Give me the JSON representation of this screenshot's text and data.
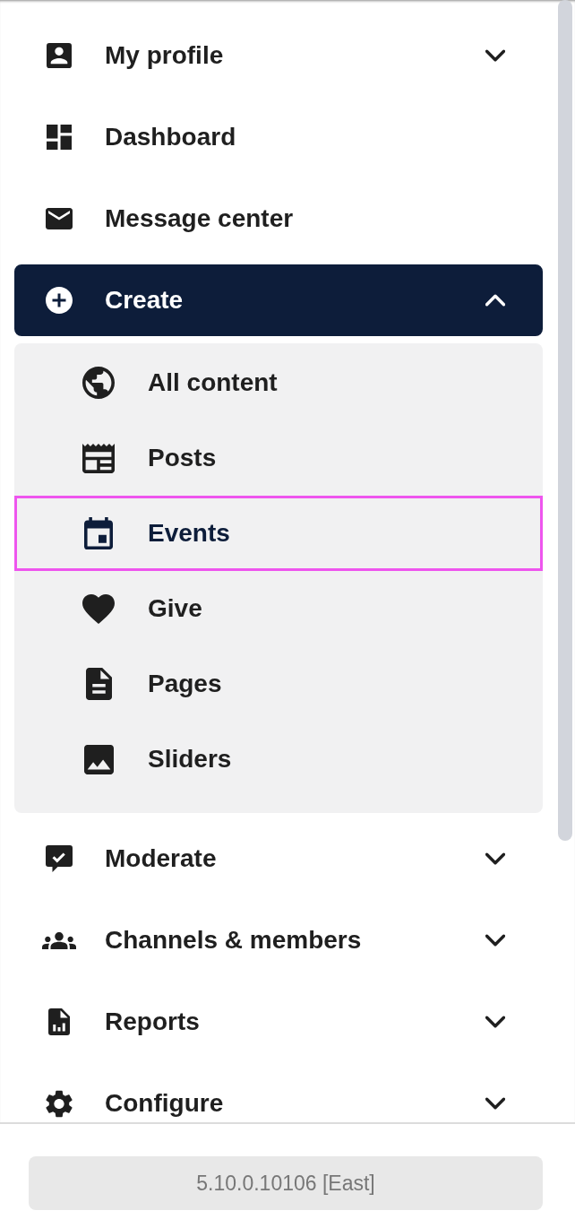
{
  "nav": {
    "items": [
      {
        "label": "My profile",
        "kind": "group",
        "expanded": false,
        "selected": false
      },
      {
        "label": "Dashboard",
        "kind": "link",
        "selected": false
      },
      {
        "label": "Message center",
        "kind": "link",
        "selected": false
      },
      {
        "label": "Create",
        "kind": "group",
        "expanded": true,
        "selected": false,
        "children": [
          {
            "label": "All content",
            "selected": false
          },
          {
            "label": "Posts",
            "selected": false
          },
          {
            "label": "Events",
            "selected": true
          },
          {
            "label": "Give",
            "selected": false
          },
          {
            "label": "Pages",
            "selected": false
          },
          {
            "label": "Sliders",
            "selected": false
          }
        ]
      },
      {
        "label": "Moderate",
        "kind": "group",
        "expanded": false,
        "selected": false
      },
      {
        "label": "Channels & members",
        "kind": "group",
        "expanded": false,
        "selected": false
      },
      {
        "label": "Reports",
        "kind": "group",
        "expanded": false,
        "selected": false
      },
      {
        "label": "Configure",
        "kind": "group",
        "expanded": false,
        "selected": false
      }
    ]
  },
  "footer": {
    "version": "5.10.0.10106 [East]"
  }
}
